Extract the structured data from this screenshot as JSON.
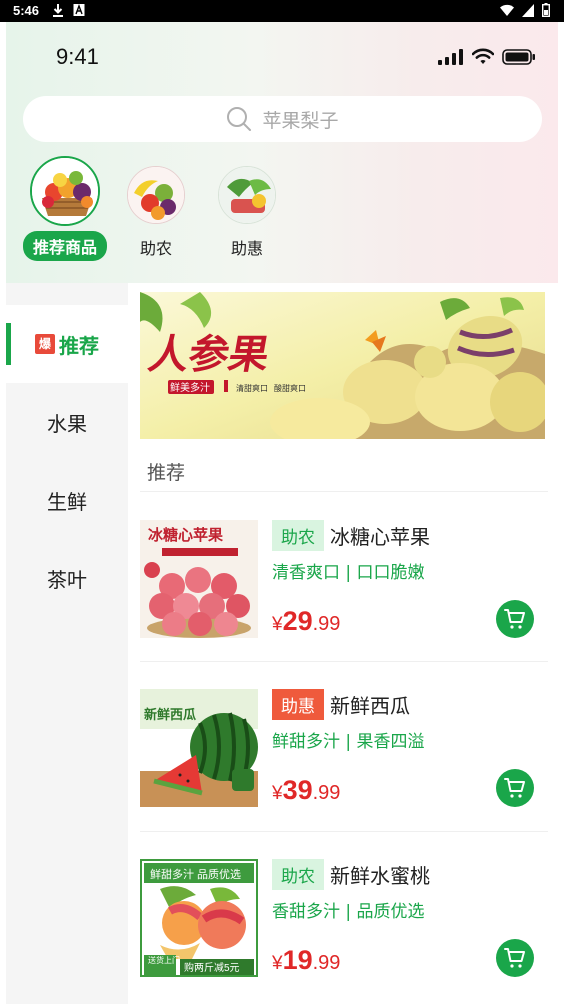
{
  "system_bar": {
    "time": "5:46"
  },
  "app_status": {
    "time": "9:41"
  },
  "search": {
    "placeholder": "苹果梨子"
  },
  "categories": [
    {
      "label": "推荐商品",
      "active": true
    },
    {
      "label": "助农",
      "active": false
    },
    {
      "label": "助惠",
      "active": false
    }
  ],
  "sidebar": {
    "items": [
      {
        "label": "推荐",
        "badge": "爆",
        "active": true
      },
      {
        "label": "水果"
      },
      {
        "label": "生鲜"
      },
      {
        "label": "茶叶"
      }
    ]
  },
  "banner": {
    "title": "人参果",
    "caption_1": "鲜美多汁",
    "caption_2": "清甜爽口",
    "caption_3": "酸甜爽口"
  },
  "section": {
    "title": "推荐"
  },
  "products": [
    {
      "tag": "助农",
      "tag_style": "green",
      "name": "冰糖心苹果",
      "desc": "清香爽口 | 口口脆嫩",
      "currency": "¥",
      "price_int": "29",
      "price_dec": ".99",
      "image_text": "冰糖心苹果"
    },
    {
      "tag": "助惠",
      "tag_style": "red",
      "name": "新鲜西瓜",
      "desc": "鲜甜多汁 | 果香四溢",
      "currency": "¥",
      "price_int": "39",
      "price_dec": ".99",
      "image_text": "新鲜西瓜"
    },
    {
      "tag": "助农",
      "tag_style": "green",
      "name": "新鲜水蜜桃",
      "desc": "香甜多汁 | 品质优选",
      "currency": "¥",
      "price_int": "19",
      "price_dec": ".99",
      "image_text_top": "鲜甜多汁 品质优选",
      "image_text_bottom_left": "送货上门",
      "image_text_bottom_right": "购两斤减5元"
    }
  ],
  "colors": {
    "accent": "#1aa64a",
    "price": "#e02828",
    "tag_red": "#ef5a3c"
  }
}
